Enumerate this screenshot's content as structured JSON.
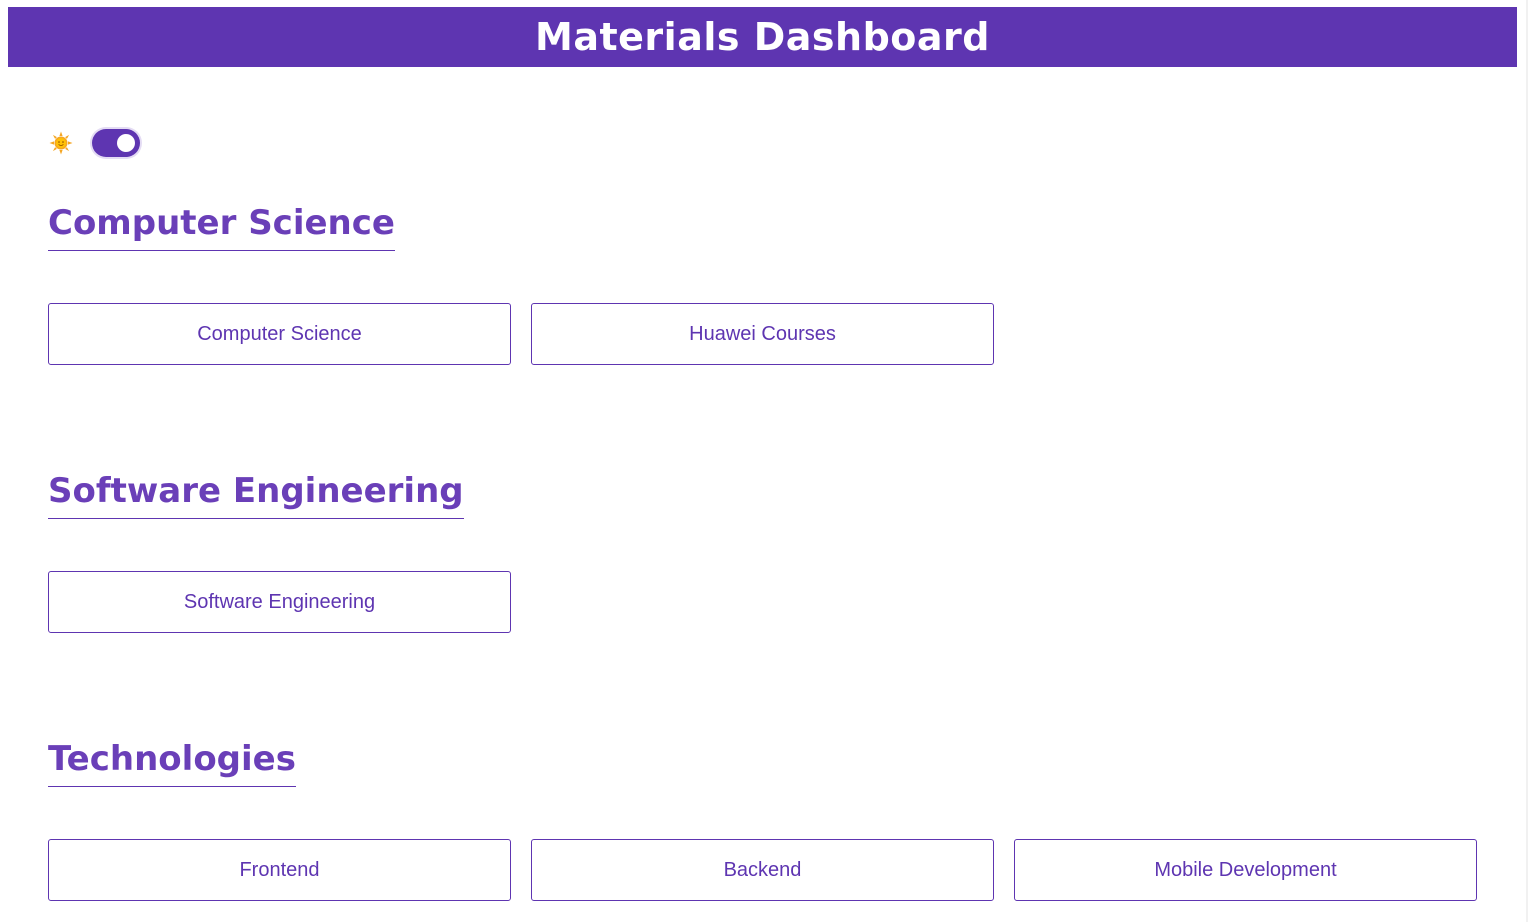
{
  "header": {
    "title": "Materials Dashboard"
  },
  "theme_toggle": {
    "icon": "sun-icon",
    "state": "on"
  },
  "sections": [
    {
      "title": "Computer Science",
      "buttons": [
        "Computer Science",
        "Huawei Courses"
      ]
    },
    {
      "title": "Software Engineering",
      "buttons": [
        "Software Engineering"
      ]
    },
    {
      "title": "Technologies",
      "buttons": [
        "Frontend",
        "Backend",
        "Mobile Development"
      ]
    }
  ],
  "colors": {
    "primary": "#5e35b1",
    "heading": "#6a3fb8",
    "sun": "#f5a623",
    "background": "#ffffff"
  }
}
